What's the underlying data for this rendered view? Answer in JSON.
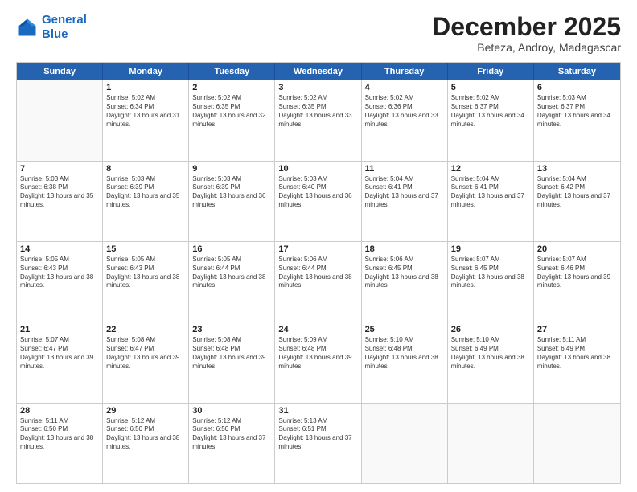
{
  "logo": {
    "line1": "General",
    "line2": "Blue"
  },
  "title": "December 2025",
  "subtitle": "Beteza, Androy, Madagascar",
  "header_days": [
    "Sunday",
    "Monday",
    "Tuesday",
    "Wednesday",
    "Thursday",
    "Friday",
    "Saturday"
  ],
  "weeks": [
    [
      {
        "day": "",
        "empty": true
      },
      {
        "day": "1",
        "sunrise": "5:02 AM",
        "sunset": "6:34 PM",
        "daylight": "13 hours and 31 minutes."
      },
      {
        "day": "2",
        "sunrise": "5:02 AM",
        "sunset": "6:35 PM",
        "daylight": "13 hours and 32 minutes."
      },
      {
        "day": "3",
        "sunrise": "5:02 AM",
        "sunset": "6:35 PM",
        "daylight": "13 hours and 33 minutes."
      },
      {
        "day": "4",
        "sunrise": "5:02 AM",
        "sunset": "6:36 PM",
        "daylight": "13 hours and 33 minutes."
      },
      {
        "day": "5",
        "sunrise": "5:02 AM",
        "sunset": "6:37 PM",
        "daylight": "13 hours and 34 minutes."
      },
      {
        "day": "6",
        "sunrise": "5:03 AM",
        "sunset": "6:37 PM",
        "daylight": "13 hours and 34 minutes."
      }
    ],
    [
      {
        "day": "7",
        "sunrise": "5:03 AM",
        "sunset": "6:38 PM",
        "daylight": "13 hours and 35 minutes."
      },
      {
        "day": "8",
        "sunrise": "5:03 AM",
        "sunset": "6:39 PM",
        "daylight": "13 hours and 35 minutes."
      },
      {
        "day": "9",
        "sunrise": "5:03 AM",
        "sunset": "6:39 PM",
        "daylight": "13 hours and 36 minutes."
      },
      {
        "day": "10",
        "sunrise": "5:03 AM",
        "sunset": "6:40 PM",
        "daylight": "13 hours and 36 minutes."
      },
      {
        "day": "11",
        "sunrise": "5:04 AM",
        "sunset": "6:41 PM",
        "daylight": "13 hours and 37 minutes."
      },
      {
        "day": "12",
        "sunrise": "5:04 AM",
        "sunset": "6:41 PM",
        "daylight": "13 hours and 37 minutes."
      },
      {
        "day": "13",
        "sunrise": "5:04 AM",
        "sunset": "6:42 PM",
        "daylight": "13 hours and 37 minutes."
      }
    ],
    [
      {
        "day": "14",
        "sunrise": "5:05 AM",
        "sunset": "6:43 PM",
        "daylight": "13 hours and 38 minutes."
      },
      {
        "day": "15",
        "sunrise": "5:05 AM",
        "sunset": "6:43 PM",
        "daylight": "13 hours and 38 minutes."
      },
      {
        "day": "16",
        "sunrise": "5:05 AM",
        "sunset": "6:44 PM",
        "daylight": "13 hours and 38 minutes."
      },
      {
        "day": "17",
        "sunrise": "5:06 AM",
        "sunset": "6:44 PM",
        "daylight": "13 hours and 38 minutes."
      },
      {
        "day": "18",
        "sunrise": "5:06 AM",
        "sunset": "6:45 PM",
        "daylight": "13 hours and 38 minutes."
      },
      {
        "day": "19",
        "sunrise": "5:07 AM",
        "sunset": "6:45 PM",
        "daylight": "13 hours and 38 minutes."
      },
      {
        "day": "20",
        "sunrise": "5:07 AM",
        "sunset": "6:46 PM",
        "daylight": "13 hours and 39 minutes."
      }
    ],
    [
      {
        "day": "21",
        "sunrise": "5:07 AM",
        "sunset": "6:47 PM",
        "daylight": "13 hours and 39 minutes."
      },
      {
        "day": "22",
        "sunrise": "5:08 AM",
        "sunset": "6:47 PM",
        "daylight": "13 hours and 39 minutes."
      },
      {
        "day": "23",
        "sunrise": "5:08 AM",
        "sunset": "6:48 PM",
        "daylight": "13 hours and 39 minutes."
      },
      {
        "day": "24",
        "sunrise": "5:09 AM",
        "sunset": "6:48 PM",
        "daylight": "13 hours and 39 minutes."
      },
      {
        "day": "25",
        "sunrise": "5:10 AM",
        "sunset": "6:48 PM",
        "daylight": "13 hours and 38 minutes."
      },
      {
        "day": "26",
        "sunrise": "5:10 AM",
        "sunset": "6:49 PM",
        "daylight": "13 hours and 38 minutes."
      },
      {
        "day": "27",
        "sunrise": "5:11 AM",
        "sunset": "6:49 PM",
        "daylight": "13 hours and 38 minutes."
      }
    ],
    [
      {
        "day": "28",
        "sunrise": "5:11 AM",
        "sunset": "6:50 PM",
        "daylight": "13 hours and 38 minutes."
      },
      {
        "day": "29",
        "sunrise": "5:12 AM",
        "sunset": "6:50 PM",
        "daylight": "13 hours and 38 minutes."
      },
      {
        "day": "30",
        "sunrise": "5:12 AM",
        "sunset": "6:50 PM",
        "daylight": "13 hours and 37 minutes."
      },
      {
        "day": "31",
        "sunrise": "5:13 AM",
        "sunset": "6:51 PM",
        "daylight": "13 hours and 37 minutes."
      },
      {
        "day": "",
        "empty": true
      },
      {
        "day": "",
        "empty": true
      },
      {
        "day": "",
        "empty": true
      }
    ]
  ]
}
